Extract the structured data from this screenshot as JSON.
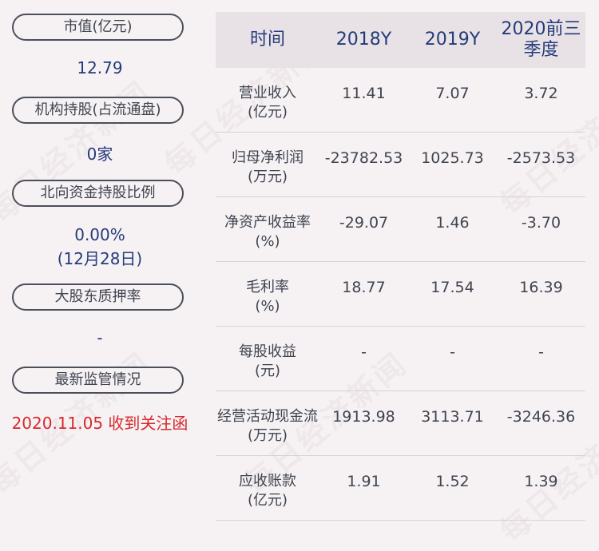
{
  "left_panel": {
    "market_cap_label": "市值(亿元)",
    "market_cap_value": "12.79",
    "institution_label": "机构持股(占流通盘)",
    "institution_value": "0家",
    "northbound_label": "北向资金持股比例",
    "northbound_value": "0.00%",
    "northbound_date": "(12月28日)",
    "pledge_label": "大股东质押率",
    "pledge_value": "-",
    "regulation_label": "最新监管情况",
    "regulation_value": "2020.11.05 收到关注函"
  },
  "table": {
    "headers": [
      "时间",
      "2018Y",
      "2019Y",
      "2020前三\n季度"
    ],
    "rows": [
      {
        "label": "营业收入\n(亿元)",
        "values": [
          "11.41",
          "7.07",
          "3.72"
        ]
      },
      {
        "label": "归母净利润\n(万元)",
        "values": [
          "-23782.53",
          "1025.73",
          "-2573.53"
        ]
      },
      {
        "label": "净资产收益率\n(%)",
        "values": [
          "-29.07",
          "1.46",
          "-3.70"
        ]
      },
      {
        "label": "毛利率\n(%)",
        "values": [
          "18.77",
          "17.54",
          "16.39"
        ]
      },
      {
        "label": "每股收益\n(元)",
        "values": [
          "-",
          "-",
          "-"
        ]
      },
      {
        "label": "经营活动现金流\n(万元)",
        "values": [
          "1913.98",
          "3113.71",
          "-3246.36"
        ]
      },
      {
        "label": "应收账款\n(亿元)",
        "values": [
          "1.91",
          "1.52",
          "1.39"
        ]
      }
    ]
  },
  "watermark_text": "每日经济新闻",
  "colors": {
    "background": "#f6f2f4",
    "value_blue": "#253b7a",
    "notice_red": "#d6292d",
    "pill_border": "#4b4f5a",
    "header_bg": "#e8e2e6"
  }
}
